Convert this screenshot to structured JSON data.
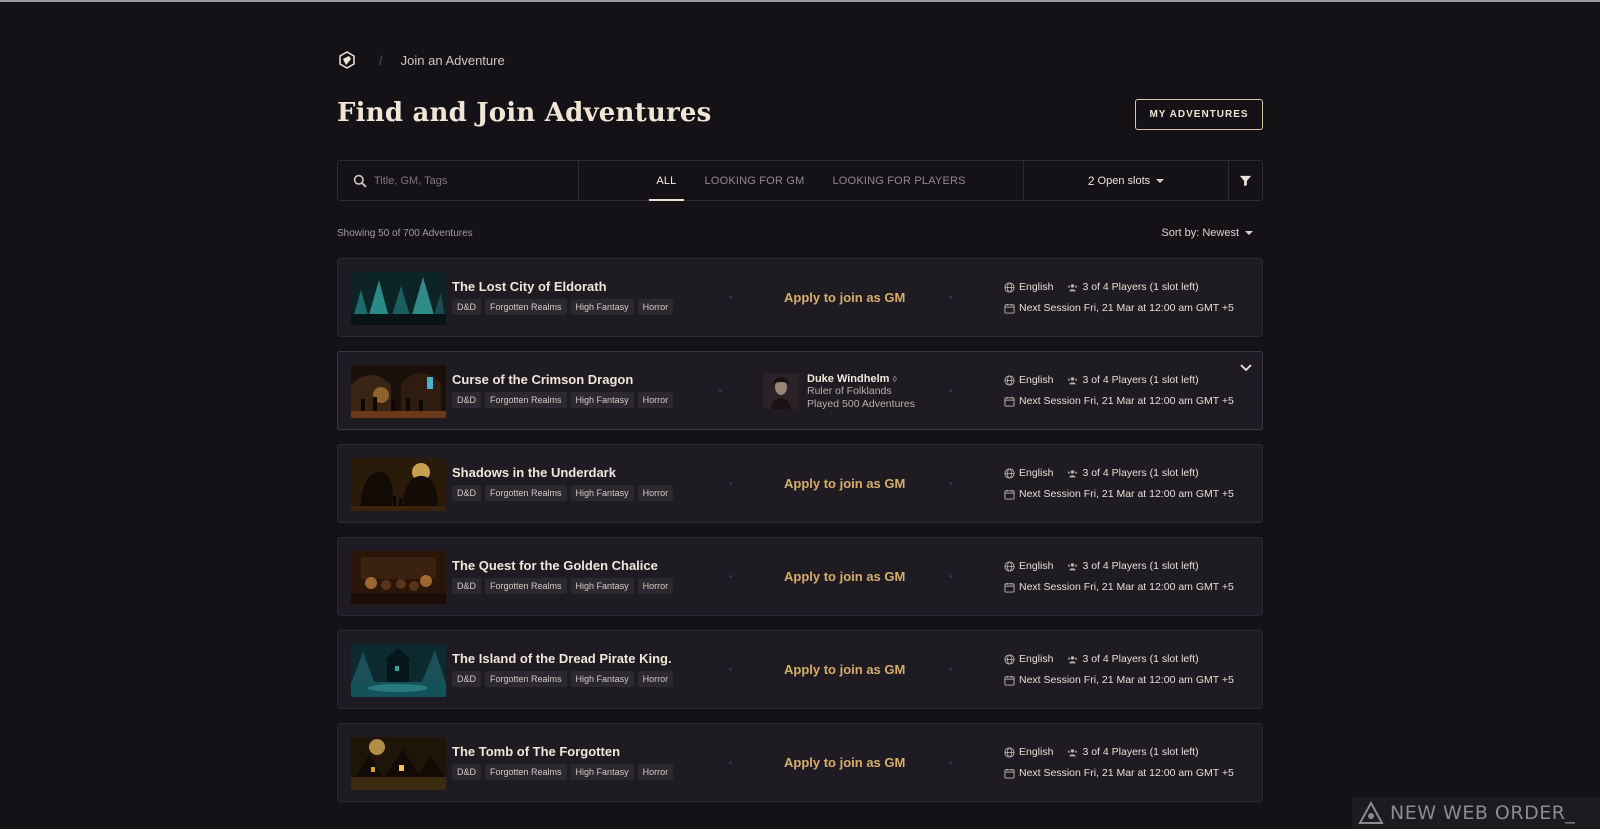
{
  "breadcrumb": {
    "current": "Join an Adventure"
  },
  "header": {
    "title": "Find and Join Adventures",
    "my_adventures_label": "MY ADVENTURES"
  },
  "filters": {
    "search_placeholder": "Title, GM, Tags",
    "search_value": "",
    "tabs": [
      {
        "label": "ALL",
        "active": true
      },
      {
        "label": "LOOKING FOR GM",
        "active": false
      },
      {
        "label": "LOOKING FOR PLAYERS",
        "active": false
      }
    ],
    "open_slots_count": "2",
    "open_slots_label": "Open slots"
  },
  "results": {
    "showing": "Showing 50 of 700 Adventures",
    "sort_label": "Sort by: Newest"
  },
  "colors": {
    "background": "#151217",
    "card": "#1f1b22",
    "accent_gold": "#d6ad6b",
    "title_cream": "#f1e6d6"
  },
  "adventures": [
    {
      "title": "The Lost City of Eldorath",
      "tags": [
        "D&D",
        "Forgotten Realms",
        "High Fantasy",
        "Horror"
      ],
      "apply_label": "Apply to join as GM",
      "language": "English",
      "players": "3 of 4 Players (1 slot left)",
      "next_session": "Next Session Fri, 21 Mar at 12:00 am GMT +5",
      "thumb_palette": [
        "#123a3e",
        "#2f8a88",
        "#0a1a1c"
      ]
    },
    {
      "title": "Curse of the Crimson Dragon",
      "tags": [
        "D&D",
        "Forgotten Realms",
        "High Fantasy",
        "Horror"
      ],
      "gm": {
        "name": "Duke Windhelm",
        "role": "Ruler of Folklands",
        "played": "Played 500 Adventures"
      },
      "language": "English",
      "players": "3 of 4 Players (1 slot left)",
      "next_session": "Next Session Fri, 21 Mar at 12:00 am GMT +5",
      "thumb_palette": [
        "#2a1a10",
        "#c98a3a",
        "#120b08"
      ]
    },
    {
      "title": "Shadows in the Underdark",
      "tags": [
        "D&D",
        "Forgotten Realms",
        "High Fantasy",
        "Horror"
      ],
      "apply_label": "Apply to join as GM",
      "language": "English",
      "players": "3 of 4 Players (1 slot left)",
      "next_session": "Next Session Fri, 21 Mar at 12:00 am GMT +5",
      "thumb_palette": [
        "#3a2a12",
        "#e0a040",
        "#140c06"
      ]
    },
    {
      "title": "The Quest for the Golden Chalice",
      "tags": [
        "D&D",
        "Forgotten Realms",
        "High Fantasy",
        "Horror"
      ],
      "apply_label": "Apply to join as GM",
      "language": "English",
      "players": "3 of 4 Players (1 slot left)",
      "next_session": "Next Session Fri, 21 Mar at 12:00 am GMT +5",
      "thumb_palette": [
        "#3b2210",
        "#d08a3a",
        "#180d06"
      ]
    },
    {
      "title": "The Island of the Dread Pirate King.",
      "tags": [
        "D&D",
        "Forgotten Realms",
        "High Fantasy",
        "Horror"
      ],
      "apply_label": "Apply to join as GM",
      "language": "English",
      "players": "3 of 4 Players (1 slot left)",
      "next_session": "Next Session Fri, 21 Mar at 12:00 am GMT +5",
      "thumb_palette": [
        "#10343a",
        "#3aa0a0",
        "#07161a"
      ]
    },
    {
      "title": "The Tomb of The Forgotten",
      "tags": [
        "D&D",
        "Forgotten Realms",
        "High Fantasy",
        "Horror"
      ],
      "apply_label": "Apply to join as GM",
      "language": "English",
      "players": "3 of 4 Players (1 slot left)",
      "next_session": "Next Session Fri, 21 Mar at 12:00 am GMT +5",
      "thumb_palette": [
        "#3a2a10",
        "#f0c060",
        "#120a04"
      ]
    }
  ],
  "watermark": {
    "text": "NEW WEB ORDER_"
  }
}
